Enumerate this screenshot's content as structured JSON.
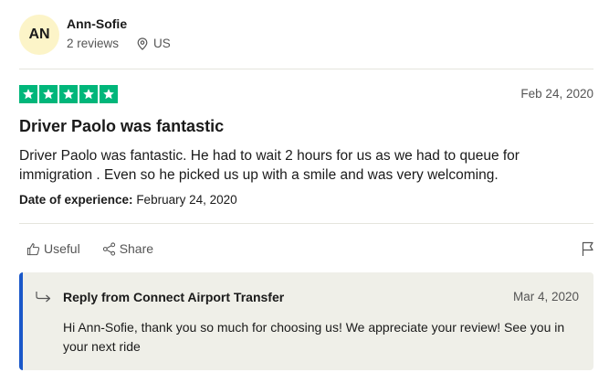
{
  "reviewer": {
    "initials": "AN",
    "name": "Ann-Sofie",
    "reviews": "2 reviews",
    "location": "US"
  },
  "review": {
    "rating": 5,
    "date": "Feb 24, 2020",
    "title": "Driver Paolo was fantastic",
    "body": "Driver Paolo was fantastic. He had to wait 2 hours for us as we had to queue for immigration . Even so he picked us up with a smile and was very welcoming.",
    "experience_label": "Date of experience:",
    "experience_date": "February 24, 2020"
  },
  "actions": {
    "useful": "Useful",
    "share": "Share"
  },
  "reply": {
    "heading": "Reply from Connect Airport Transfer",
    "date": "Mar 4, 2020",
    "text": "Hi Ann-Sofie, thank you so much for choosing us! We appreciate your review! See you in your next ride"
  },
  "colors": {
    "star": "#00b67a",
    "reply_accent": "#1a58c9",
    "reply_background": "#efefe8",
    "avatar_background": "#fcf4c8"
  },
  "icons": [
    "location-pin-icon",
    "star-icon",
    "thumbs-up-icon",
    "share-icon",
    "flag-icon",
    "reply-arrow-icon"
  ]
}
